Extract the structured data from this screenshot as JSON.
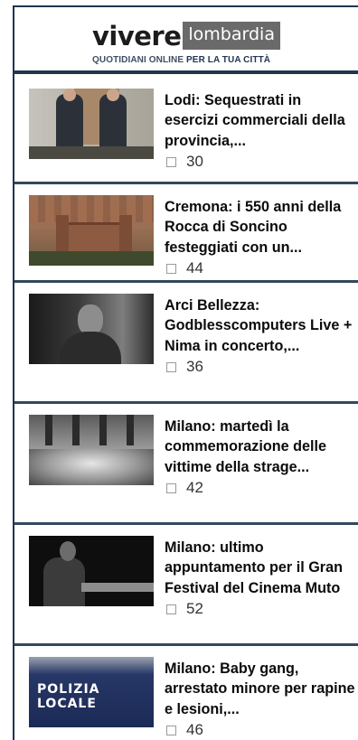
{
  "header": {
    "logo_main": "vivere",
    "logo_box": "lombardia",
    "tagline_prefix": "QUOTIDIANI ONLINE ",
    "tagline_suffix": "PER LA TUA CITTÀ"
  },
  "articles": [
    {
      "title": "Lodi: Sequestrati in esercizi commerciali della provincia,...",
      "comments": "30",
      "comment_icon": "comment-icon"
    },
    {
      "title": "Cremona: i 550 anni della Rocca di Soncino festeggiati con un...",
      "comments": "44",
      "comment_icon": "comment-icon"
    },
    {
      "title": "Arci Bellezza: Godblesscomputers Live + Nima in concerto,...",
      "comments": "36",
      "comment_icon": "comment-icon"
    },
    {
      "title": "Milano: martedì la commemorazione delle vittime della strage...",
      "comments": "42",
      "comment_icon": "comment-icon"
    },
    {
      "title": "Milano: ultimo appuntamento per il Gran Festival del Cinema Muto",
      "comments": "52",
      "comment_icon": "comment-icon"
    },
    {
      "title": "Milano: Baby gang, arrestato minore per rapine e lesioni,...",
      "comments": "46",
      "comment_icon": "comment-icon",
      "thumb_text_1": "POLIZIA",
      "thumb_text_2": "LOCALE"
    }
  ],
  "colors": {
    "frame": "#1f3550",
    "divider": "#34475c",
    "logo_box": "#6a6a6a"
  }
}
